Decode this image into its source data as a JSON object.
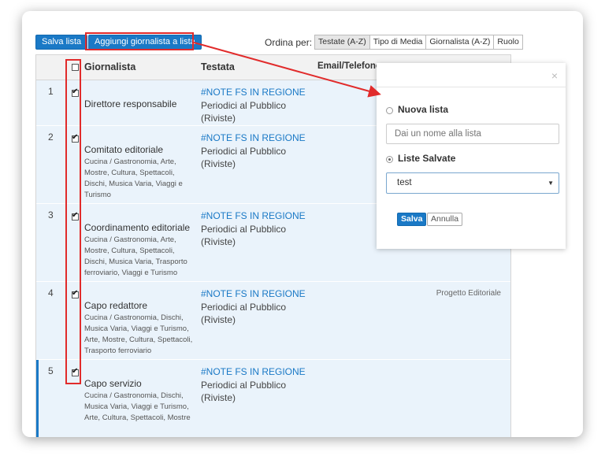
{
  "toolbar": {
    "save_list_label": "Salva lista",
    "add_journalist_label": "Aggiungi giornalista a lista",
    "sort_label": "Ordina per:",
    "sort_options": [
      "Testate (A-Z)",
      "Tipo di Media",
      "Giornalista (A-Z)",
      "Ruolo"
    ]
  },
  "table": {
    "headers": {
      "journalist": "Giornalista",
      "publication": "Testata",
      "contact": "Email/Telefono"
    },
    "rows": [
      {
        "num": "1",
        "role": "Direttore responsabile",
        "tags": "",
        "pub_name": "#NOTE FS IN REGIONE",
        "pub_type_1": "Periodici al Pubblico",
        "pub_type_2": "(Riviste)",
        "note": ""
      },
      {
        "num": "2",
        "role": "Comitato editoriale",
        "tags": "Cucina / Gastronomia, Arte, Mostre, Cultura, Spettacoli, Dischi, Musica Varia, Viaggi e Turismo",
        "pub_name": "#NOTE FS IN REGIONE",
        "pub_type_1": "Periodici al Pubblico",
        "pub_type_2": "(Riviste)",
        "note": ""
      },
      {
        "num": "3",
        "role": "Coordinamento editoriale",
        "tags": "Cucina / Gastronomia, Arte, Mostre, Cultura, Spettacoli, Dischi, Musica Varia, Trasporto ferroviario, Viaggi e Turismo",
        "pub_name": "#NOTE FS IN REGIONE",
        "pub_type_1": "Periodici al Pubblico",
        "pub_type_2": "(Riviste)",
        "note": ""
      },
      {
        "num": "4",
        "role": "Capo redattore",
        "tags": "Cucina / Gastronomia, Dischi, Musica Varia, Viaggi e Turismo, Arte, Mostre, Cultura, Spettacoli, Trasporto ferroviario",
        "pub_name": "#NOTE FS IN REGIONE",
        "pub_type_1": "Periodici al Pubblico",
        "pub_type_2": "(Riviste)",
        "note": "Progetto Editoriale"
      },
      {
        "num": "5",
        "role": "Capo servizio",
        "tags": "Cucina / Gastronomia, Dischi, Musica Varia, Viaggi e Turismo, Arte, Cultura, Spettacoli, Mostre",
        "pub_name": "#NOTE FS IN REGIONE",
        "pub_type_1": "Periodici al Pubblico",
        "pub_type_2": "(Riviste)",
        "note": ""
      }
    ]
  },
  "modal": {
    "close": "×",
    "new_list_label": "Nuova lista",
    "name_placeholder": "Dai un nome alla lista",
    "saved_lists_label": "Liste Salvate",
    "selected_list": "test",
    "save_label": "Salva",
    "cancel_label": "Annulla"
  },
  "colors": {
    "accent": "#1a79c6",
    "highlight": "#e12b2b",
    "row_bg": "#eaf3fb"
  }
}
